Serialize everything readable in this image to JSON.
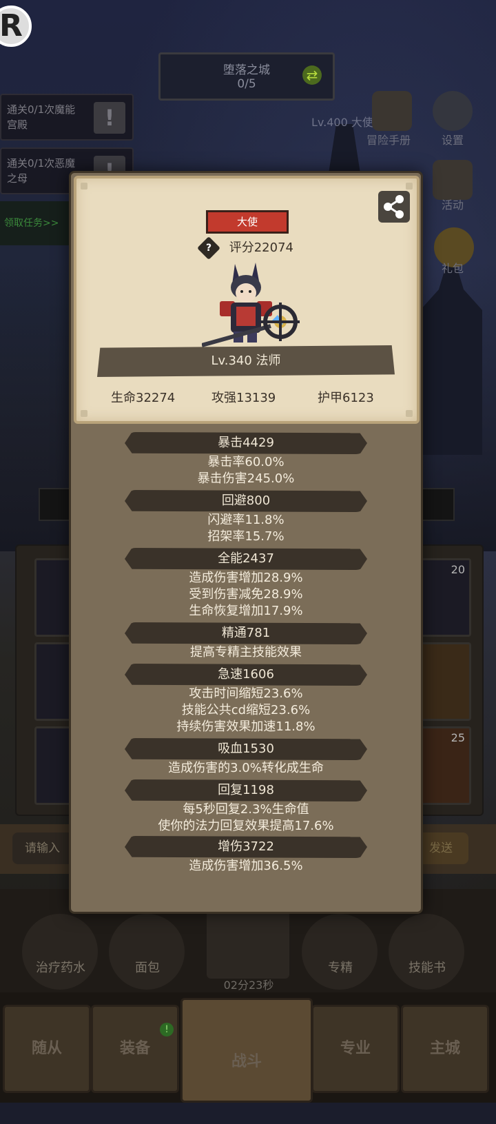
{
  "background": {
    "stage": {
      "name": "堕落之城",
      "progress": "0/5"
    },
    "quests": [
      {
        "text": "通关0/1次魔能宫殿"
      },
      {
        "text": "通关0/1次恶魔之母"
      },
      {
        "text": "领取任务>>"
      }
    ],
    "player_line": "Lv.400 大使牢大:",
    "side_menu": {
      "adventure_manual": "冒险手册",
      "settings": "设置",
      "activity": "活动",
      "gift": "礼包"
    },
    "slots": {
      "count_a": "20",
      "count_b": "25"
    },
    "chat": {
      "input_placeholder": "请输入",
      "send_label": "发送"
    },
    "items": [
      {
        "label": "治疗药水"
      },
      {
        "label": "面包"
      },
      {
        "label": "专精"
      },
      {
        "label": "技能书"
      }
    ],
    "timer": "02分23秒",
    "nav": {
      "followers": "随从",
      "equipment": "装备",
      "battle": "战斗",
      "profession": "专业",
      "main_city": "主城",
      "badge": "!"
    }
  },
  "profile": {
    "title_badge": "大使",
    "score_label": "评分22074",
    "level_class": "Lv.340 法师",
    "main_stats": {
      "hp": "生命32274",
      "attack": "攻强13139",
      "armor": "护甲6123"
    }
  },
  "attributes": [
    {
      "head": "暴击4429",
      "lines": [
        "暴击率60.0%",
        "暴击伤害245.0%"
      ]
    },
    {
      "head": "回避800",
      "lines": [
        "闪避率11.8%",
        "招架率15.7%"
      ]
    },
    {
      "head": "全能2437",
      "lines": [
        "造成伤害增加28.9%",
        "受到伤害减免28.9%",
        "生命恢复增加17.9%"
      ]
    },
    {
      "head": "精通781",
      "lines": [
        "提高专精主技能效果"
      ]
    },
    {
      "head": "急速1606",
      "lines": [
        "攻击时间缩短23.6%",
        "技能公共cd缩短23.6%",
        "持续伤害效果加速11.8%"
      ]
    },
    {
      "head": "吸血1530",
      "lines": [
        "造成伤害的3.0%转化成生命"
      ]
    },
    {
      "head": "回复1198",
      "lines": [
        "每5秒回复2.3%生命值",
        "使你的法力回复效果提高17.6%"
      ]
    },
    {
      "head": "增伤3722",
      "lines": [
        "造成伤害增加36.5%"
      ]
    }
  ]
}
